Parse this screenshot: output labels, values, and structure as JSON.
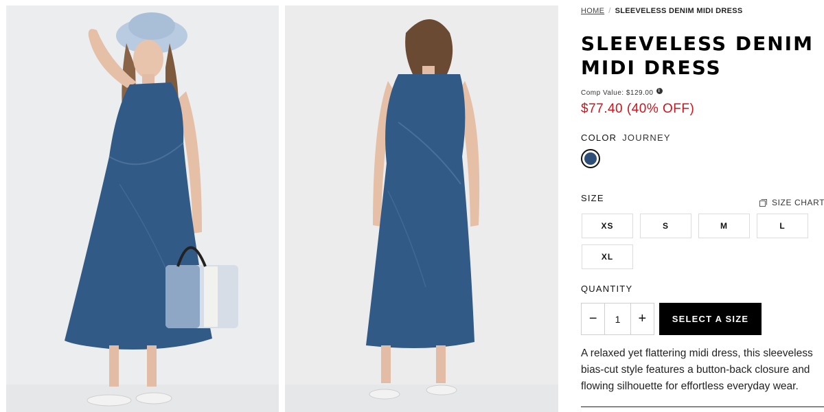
{
  "breadcrumb": {
    "home": "HOME",
    "separator": "/",
    "current": "SLEEVELESS DENIM MIDI DRESS"
  },
  "product": {
    "title": "SLEEVELESS DENIM MIDI DRESS",
    "comp_value": "Comp Value: $129.00",
    "info_icon": "i",
    "price": "$77.40 (40% OFF)",
    "price_color": "#d0121b"
  },
  "color": {
    "label": "COLOR",
    "value": "JOURNEY",
    "swatch_hex": "#2e4f78"
  },
  "size": {
    "label": "SIZE",
    "chart_link": "SIZE CHART",
    "options": [
      "XS",
      "S",
      "M",
      "L",
      "XL"
    ]
  },
  "quantity": {
    "label": "QUANTITY",
    "minus": "−",
    "value": "1",
    "plus": "+"
  },
  "cta": {
    "label": "SELECT A SIZE"
  },
  "description": "A relaxed yet flattering midi dress, this sleeveless bias-cut style features a button-back closure and flowing silhouette for effortless everyday wear.",
  "images": {
    "front": {
      "alt_icon": "model-front-image"
    },
    "back": {
      "alt_icon": "model-back-image"
    }
  }
}
